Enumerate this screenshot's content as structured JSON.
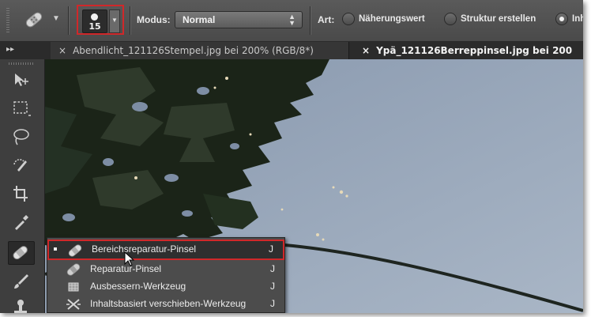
{
  "options_bar": {
    "tool_preset_icon": "spot-healing-brush-icon",
    "brush_size": "15",
    "mode_label": "Modus:",
    "mode_value": "Normal",
    "type_label": "Art:",
    "radio_options": [
      "Näherungswert",
      "Struktur erstellen",
      "Inh"
    ],
    "selected_radio": 2,
    "highlight_color": "#d0282a"
  },
  "tabs": [
    {
      "title": "Abendlicht_121126Stempel.jpg bei 200% (RGB/8*)",
      "active": false,
      "close": "×"
    },
    {
      "title": "Ypä_121126Berreppinsel.jpg bei 200",
      "active": true,
      "close": "×"
    }
  ],
  "tools": [
    "move-tool-icon",
    "marquee-tool-icon",
    "lasso-tool-icon",
    "quick-selection-tool-icon",
    "crop-tool-icon",
    "eyedropper-tool-icon",
    "spot-healing-brush-tool-icon",
    "brush-tool-icon",
    "clone-stamp-tool-icon"
  ],
  "flyout": {
    "items": [
      {
        "label": "Bereichsreparatur-Pinsel",
        "shortcut": "J",
        "icon": "spot-healing-brush-icon",
        "selected": true
      },
      {
        "label": "Reparatur-Pinsel",
        "shortcut": "J",
        "icon": "healing-brush-icon",
        "selected": false
      },
      {
        "label": "Ausbessern-Werkzeug",
        "shortcut": "J",
        "icon": "patch-tool-icon",
        "selected": false
      },
      {
        "label": "Inhaltsbasiert verschieben-Werkzeug",
        "shortcut": "J",
        "icon": "content-aware-move-icon",
        "selected": false
      }
    ]
  }
}
